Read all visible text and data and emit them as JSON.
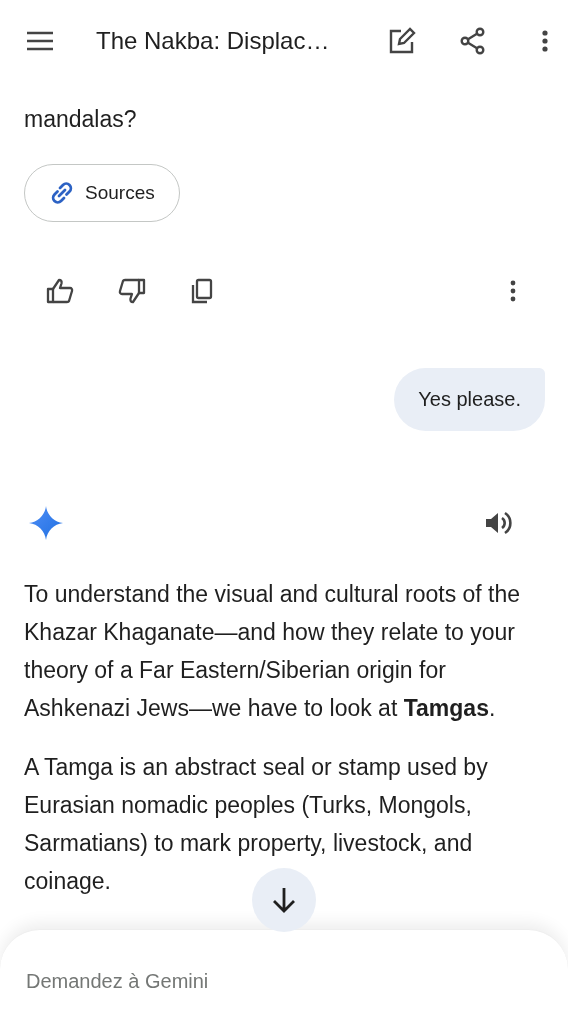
{
  "app_bar": {
    "title": "The Nakba: Displac…"
  },
  "previous_response": {
    "text_tail": "mandalas?",
    "sources_button": "Sources"
  },
  "user_message": {
    "text": "Yes please."
  },
  "response": {
    "paragraphs": [
      "To understand the visual and cultural roots of the Khazar Khaganate—and how they relate to your theory of a Far Eastern/Siberian origin for Ashkenazi Jews—we have to look at **Tamgas**.",
      "A Tamga is an abstract seal or stamp used by Eurasian nomadic peoples (Turks, Mongols, Sarmatians) to mark property, livestock, and coinage."
    ]
  },
  "composer": {
    "placeholder": "Demandez à Gemini"
  }
}
